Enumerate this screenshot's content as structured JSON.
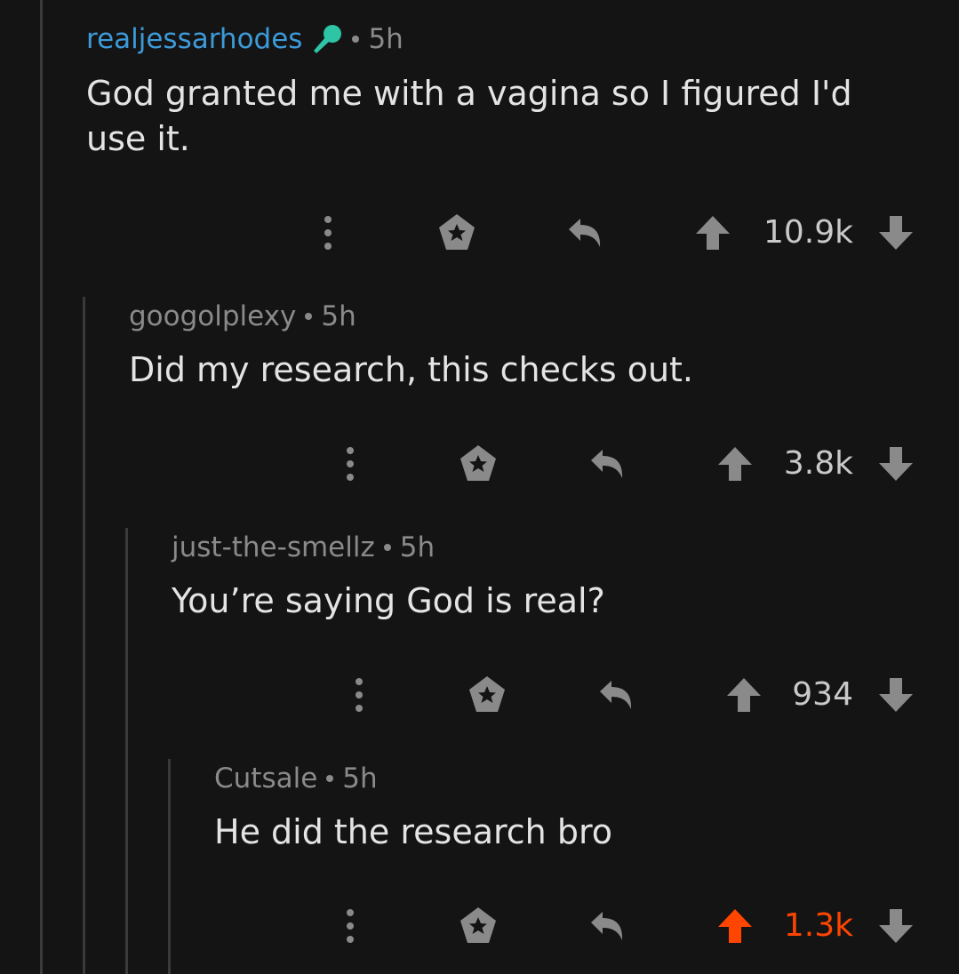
{
  "colors": {
    "background": "#141414",
    "op_username": "#3d9ad9",
    "meta_text": "#8a8a8a",
    "body_text": "#e4e4e4",
    "icon": "#8a8a8a",
    "upvoted": "#ff4500"
  },
  "comments": [
    {
      "username": "realjessarhodes",
      "flair_icon": "microphone-icon",
      "age": "5h",
      "body": "God granted me with a vagina so I figured I'd use it.",
      "score": "10.9k",
      "upvoted": false
    },
    {
      "username": "googolplexy",
      "age": "5h",
      "body": "Did my research, this checks out.",
      "score": "3.8k",
      "upvoted": false
    },
    {
      "username": "just-the-smellz",
      "age": "5h",
      "body": "You’re saying God is real?",
      "score": "934",
      "upvoted": false
    },
    {
      "username": "Cutsale",
      "age": "5h",
      "body": "He did the research bro",
      "score": "1.3k",
      "upvoted": true
    }
  ]
}
